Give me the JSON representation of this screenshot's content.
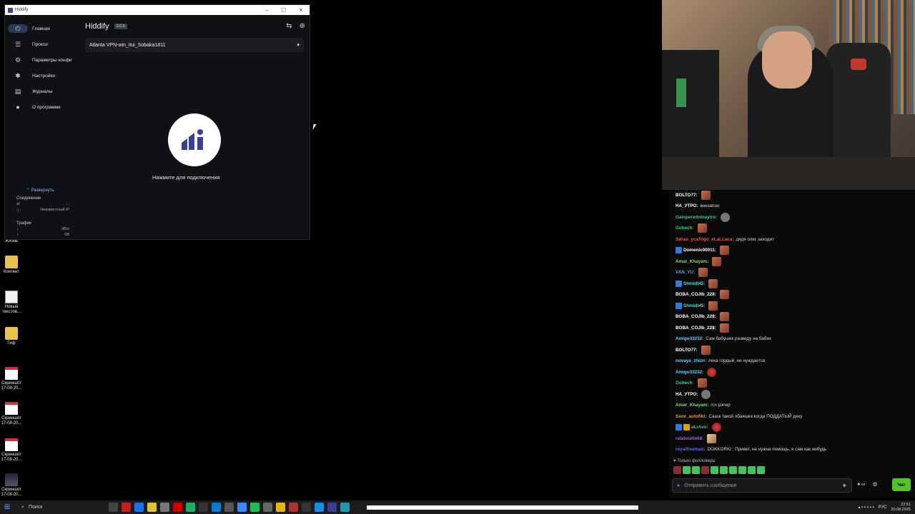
{
  "desktop": {
    "icons": [
      {
        "label": "Жизнь",
        "icon": "folder-icon"
      },
      {
        "label": "Контент",
        "icon": "folder-icon"
      },
      {
        "label": "Новый текстов...",
        "icon": "text-file-icon"
      },
      {
        "label": "Гиф",
        "icon": "folder-icon"
      },
      {
        "label": "Скриншот 17-08-20...",
        "icon": "image-file-icon"
      },
      {
        "label": "Скриншот 17-08-20...",
        "icon": "image-file-icon"
      },
      {
        "label": "Скриншот 17-08-20...",
        "icon": "image-file-icon"
      },
      {
        "label": "Скриншот 17-08-20...",
        "icon": "image-file-icon"
      }
    ]
  },
  "hiddify": {
    "window_title": "Hiddify",
    "app_title": "Hiddify",
    "version": "2.0.5",
    "nav": [
      {
        "label": "Главная",
        "icon": "power-icon",
        "active": true
      },
      {
        "label": "Прокси",
        "icon": "filter-list-icon"
      },
      {
        "label": "Параметры конфи",
        "icon": "config-icon"
      },
      {
        "label": "Настройки",
        "icon": "gear-icon"
      },
      {
        "label": "Журналы",
        "icon": "document-icon"
      },
      {
        "label": "О программе",
        "icon": "info-icon"
      }
    ],
    "expand_label": "Развернуть",
    "connection_label": "Соединение",
    "connection_value": "...",
    "ip_label": "Неизвестный IP",
    "traffic_label": "Трафик",
    "traffic_down": "0B/s",
    "traffic_total": "0B",
    "profile_name": "Atlanta VPN-win_itui_Sobaka1811",
    "connect_text": "Нажмите для подключения"
  },
  "chat": {
    "messages": [
      {
        "user": "BOLTO77",
        "color": "#ffffff",
        "text": "",
        "emote": "emote"
      },
      {
        "user": "НА_УТРО",
        "color": "#ffffff",
        "text": "внезапно",
        "emote": ""
      },
      {
        "user": "Galoperedolnaytro",
        "color": "#3dd37a",
        "text": "",
        "emote": "gray"
      },
      {
        "user": "Gobech",
        "color": "#3dd37a",
        "text": "",
        "emote": "emote"
      },
      {
        "user": "3ahax_ycaTogo_eLaLLaca",
        "color": "#e05a5a",
        "text": "дядя олег заходит",
        "emote": ""
      },
      {
        "user": "Domenic00011",
        "color": "#ffffff",
        "text": "",
        "emote": "emote",
        "badge": true
      },
      {
        "user": "Amar_Khayam",
        "color": "#8cd86b",
        "text": "",
        "emote": "emote"
      },
      {
        "user": "VAN_YU",
        "color": "#5b9ddb",
        "text": "",
        "emote": "emote"
      },
      {
        "user": "Shmidt45",
        "color": "#5fd4d4",
        "text": "",
        "emote": "emote",
        "badge": true
      },
      {
        "user": "BOBA_COJIb_228",
        "color": "#ffffff",
        "text": "",
        "emote": "emote"
      },
      {
        "user": "Shmidt45",
        "color": "#5fd4d4",
        "text": "",
        "emote": "emote",
        "badge": true
      },
      {
        "user": "BOBA_COJIb_228",
        "color": "#ffffff",
        "text": "",
        "emote": "emote"
      },
      {
        "user": "BOBA_COJIb_228",
        "color": "#ffffff",
        "text": "",
        "emote": "emote"
      },
      {
        "user": "Amigo33232",
        "color": "#6fd0ff",
        "text": "Сам бабушек разведу на бабки",
        "emote": ""
      },
      {
        "user": "BOLTO77",
        "color": "#ffffff",
        "text": "",
        "emote": "emote"
      },
      {
        "user": "novaya_zhizn",
        "color": "#6fd0ff",
        "text": "леха гордый, не нуждается",
        "emote": ""
      },
      {
        "user": "Amigo33232",
        "color": "#6fd0ff",
        "text": "",
        "emote": "red"
      },
      {
        "user": "Gobech",
        "color": "#3dd37a",
        "text": "",
        "emote": "emote"
      },
      {
        "user": "НА_УТРО",
        "color": "#ffffff",
        "text": "",
        "emote": "gray"
      },
      {
        "user": "Amar_Khayam",
        "color": "#8cd86b",
        "text": "гсч рэпер",
        "emote": ""
      },
      {
        "user": "Semi_autofikt",
        "color": "#e09a3a",
        "text": "Саша такой обаяшка когда ПОДДАТЫЙ деку",
        "emote": ""
      },
      {
        "user": "aLrAvo",
        "color": "#3dd37a",
        "text": "",
        "emote": "red",
        "badge": true,
        "badge2": true
      },
      {
        "user": "ratatouille68",
        "color": "#b05ae0",
        "text": "",
        "emote": "pale"
      },
      {
        "user": "royalfreeman",
        "color": "#5a6ae0",
        "text": "DOKKORKI : Привет, не нужна помощь, я сам как нибудь",
        "emote": ""
      }
    ],
    "followers_only": "Только фолловеры",
    "input_placeholder": "Отправить сообщение",
    "chat_button": "Чат",
    "accent": "#53c427"
  },
  "taskbar": {
    "search_label": "Поиск",
    "language": "РУС",
    "time": "23:51",
    "date": "20.08.2025"
  }
}
